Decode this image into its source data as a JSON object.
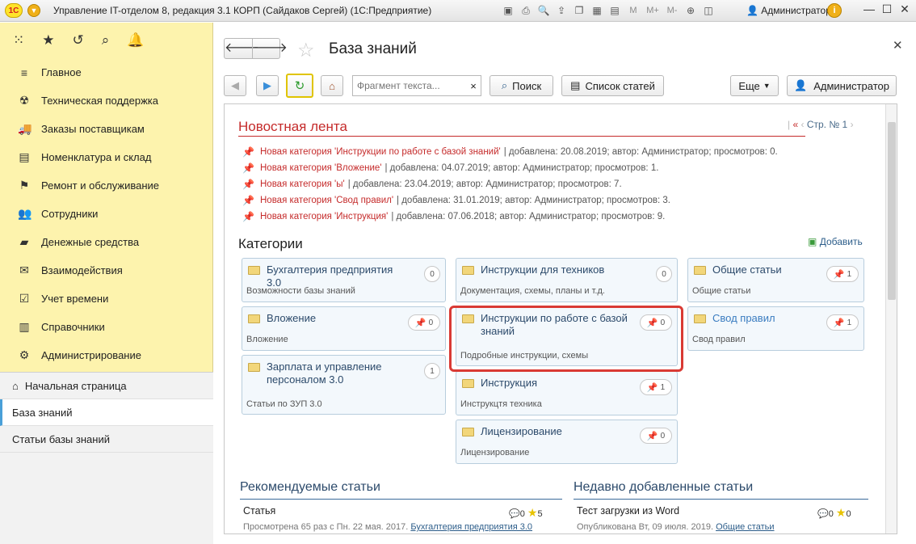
{
  "titlebar": {
    "logo_text": "1С",
    "title": "Управление IT-отделом 8, редакция 3.1 КОРП (Сайдаков Сергей)  (1С:Предприятие)",
    "user": "Администратор",
    "icons": [
      "save-icon",
      "print-icon",
      "preview-icon",
      "upload-icon",
      "copy-icon",
      "calendar-icon",
      "calculator-icon",
      "zoom-icon",
      "panels-icon"
    ],
    "m_labels": [
      "M",
      "M+",
      "M-"
    ]
  },
  "sidebar": {
    "top_icons": [
      "apps-icon",
      "star-icon",
      "history-icon",
      "search-icon",
      "bell-icon"
    ],
    "items": [
      {
        "label": "Главное",
        "icon": "≡",
        "icon_name": "menu-icon"
      },
      {
        "label": "Техническая поддержка",
        "icon": "☢",
        "icon_name": "support-icon"
      },
      {
        "label": "Заказы поставщикам",
        "icon": "🚚",
        "icon_name": "truck-icon"
      },
      {
        "label": "Номенклатура и склад",
        "icon": "▤",
        "icon_name": "warehouse-icon"
      },
      {
        "label": "Ремонт и обслуживание",
        "icon": "⚑",
        "icon_name": "repair-icon"
      },
      {
        "label": "Сотрудники",
        "icon": "👥",
        "icon_name": "employees-icon"
      },
      {
        "label": "Денежные средства",
        "icon": "▰",
        "icon_name": "money-icon"
      },
      {
        "label": "Взаимодействия",
        "icon": "✉",
        "icon_name": "envelope-icon"
      },
      {
        "label": "Учет времени",
        "icon": "☑",
        "icon_name": "time-icon"
      },
      {
        "label": "Справочники",
        "icon": "▥",
        "icon_name": "reference-icon"
      },
      {
        "label": "Администрирование",
        "icon": "⚙",
        "icon_name": "gear-icon"
      }
    ],
    "lower": {
      "home": "Начальная страница",
      "knowledge_base": "База знаний",
      "articles": "Статьи базы знаний"
    }
  },
  "main": {
    "title": "База знаний",
    "toolbar": {
      "search_placeholder": "Фрагмент текста...",
      "clear": "×",
      "find": "Поиск",
      "article_list": "Список статей",
      "more": "Еще",
      "user": "Администратор"
    },
    "news": {
      "heading": "Новостная лента",
      "pager_prev": "«",
      "pager_back": "‹",
      "pager_label": "Стр. № 1",
      "pager_next": "›",
      "items": [
        {
          "title": "Новая категория 'Инструкции по работе с базой знаний'",
          "meta": "| добавлена: 20.08.2019; автор: Администратор; просмотров: 0."
        },
        {
          "title": "Новая категория 'Вложение'",
          "meta": "| добавлена: 04.07.2019; автор: Администратор; просмотров: 1."
        },
        {
          "title": "Новая категория 'ы'",
          "meta": "| добавлена: 23.04.2019; автор: Администратор; просмотров: 7."
        },
        {
          "title": "Новая категория 'Свод правил'",
          "meta": "| добавлена: 31.01.2019; автор: Администратор; просмотров: 3."
        },
        {
          "title": "Новая категория 'Инструкция'",
          "meta": "| добавлена: 07.06.2018; автор: Администратор; просмотров: 9."
        }
      ]
    },
    "categories": {
      "heading": "Категории",
      "add": "Добавить",
      "cards": [
        {
          "title": "Бухгалтерия предприятия 3.0",
          "desc": "Возможности базы знаний",
          "badge": "0",
          "pinned": false
        },
        {
          "title": "Инструкции для техников",
          "desc": "Документация, схемы, планы и т.д.",
          "badge": "0",
          "pinned": false
        },
        {
          "title": "Общие статьи",
          "desc": "Общие статьи",
          "badge": "1",
          "pinned": true
        },
        {
          "title": "Вложение",
          "desc": "Вложение",
          "badge": "0",
          "pinned": true
        },
        {
          "title": "Инструкции по работе с базой знаний",
          "desc": "Подробные инструкции, схемы",
          "badge": "0",
          "pinned": true
        },
        {
          "title": "Свод правил",
          "desc": "Свод правил",
          "badge": "1",
          "pinned": true
        },
        {
          "title": "Зарплата и управление персоналом 3.0",
          "desc": "Статьи по ЗУП 3.0",
          "badge": "1",
          "pinned": false
        },
        {
          "title": "Инструкция",
          "desc": "Инструкцтя техника",
          "badge": "1",
          "pinned": true
        },
        {
          "title": "Лицензирование",
          "desc": "Лицензирование",
          "badge": "0",
          "pinned": true
        }
      ]
    },
    "recommended": {
      "heading": "Рекомендуемые статьи",
      "article_title": "Статья",
      "meta": "Просмотрена 65 раз с Пн. 22 мая. 2017.",
      "link": "Бухгалтерия предприятия 3.0",
      "comments": "0",
      "stars": "5"
    },
    "recent": {
      "heading": "Недавно добавленные статьи",
      "article_title": "Тест загрузки из Word",
      "meta": "Опубликована Вт, 09 июля. 2019.",
      "link": "Общие статьи",
      "comments": "0",
      "stars": "0"
    }
  },
  "colors": {
    "sidebar_bg": "#fdf3ad",
    "news_red": "#c52b2b",
    "highlight": "#d93a34",
    "link": "#2c5d8a"
  }
}
